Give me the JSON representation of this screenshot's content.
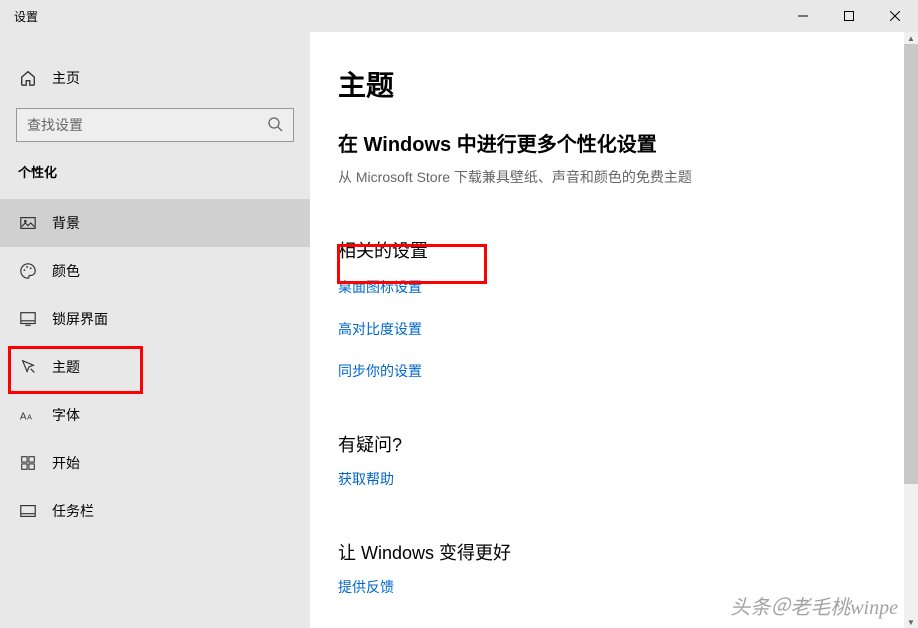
{
  "window": {
    "title": "设置"
  },
  "sidebar": {
    "home_label": "主页",
    "search_placeholder": "查找设置",
    "category": "个性化",
    "items": [
      {
        "label": "背景",
        "selected": true,
        "icon": "background"
      },
      {
        "label": "颜色",
        "selected": false,
        "icon": "colors"
      },
      {
        "label": "锁屏界面",
        "selected": false,
        "icon": "lockscreen"
      },
      {
        "label": "主题",
        "selected": false,
        "icon": "themes"
      },
      {
        "label": "字体",
        "selected": false,
        "icon": "fonts"
      },
      {
        "label": "开始",
        "selected": false,
        "icon": "start"
      },
      {
        "label": "任务栏",
        "selected": false,
        "icon": "taskbar"
      }
    ]
  },
  "main": {
    "page_title": "主题",
    "more_title": "在 Windows 中进行更多个性化设置",
    "more_subtitle": "从 Microsoft Store 下载兼具壁纸、声音和颜色的免费主题",
    "related": {
      "label": "相关的设置",
      "links": [
        "桌面图标设置",
        "高对比度设置",
        "同步你的设置"
      ]
    },
    "question": {
      "label": "有疑问?",
      "link": "获取帮助"
    },
    "feedback": {
      "label": "让 Windows 变得更好",
      "link": "提供反馈"
    }
  },
  "watermark": "头条＠老毛桃winpe"
}
